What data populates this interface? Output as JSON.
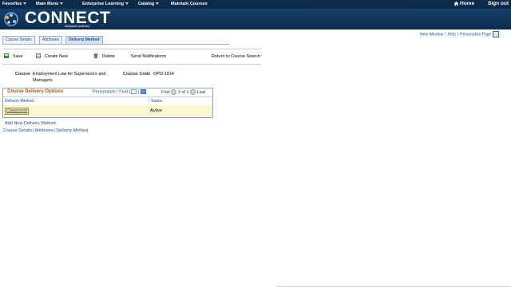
{
  "topnav": {
    "favorites": "Favorites",
    "main_menu": "Main Menu",
    "enterprise_learning": "Enterprise Learning",
    "catalog": "Catalog",
    "maintain_courses": "Maintain Courses",
    "home": "Home",
    "sign_out": "Sign out"
  },
  "banner": {
    "logo_text": "CONNECT",
    "logo_sub": "Maryland Judiciary",
    "brand_color": "#0d2a48"
  },
  "utility_links": {
    "new_window": "New Window",
    "help": "Help",
    "personalize_page": "Personalize Page"
  },
  "tabs": [
    {
      "label": "Course Details",
      "active": false
    },
    {
      "label": "Attributes",
      "active": false
    },
    {
      "label": "Delivery Method",
      "active": true
    }
  ],
  "toolbar": {
    "save": "Save",
    "create_new": "Create New",
    "delete": "Delete",
    "send_notifications": "Send Notifications",
    "return": "Return to Course Search"
  },
  "course": {
    "course_label": "Course",
    "course_value_line1": "Employment Law for Supervisors and",
    "course_value_line2": "Managers",
    "code_label": "Course Code",
    "code_value": "OPD-1014"
  },
  "grid": {
    "title": "Course Delivery Options",
    "personalize": "Personalize",
    "find": "Find",
    "first": "First",
    "range": "1 of 1",
    "last": "Last",
    "col_method": "Delivery Method",
    "col_status": "Status",
    "rows": [
      {
        "method": "Classroom",
        "status": "Active"
      }
    ]
  },
  "add_link": "Add New Delivery Method",
  "bottom_links": [
    "Course Details",
    "Attributes",
    "Delivery Method"
  ]
}
